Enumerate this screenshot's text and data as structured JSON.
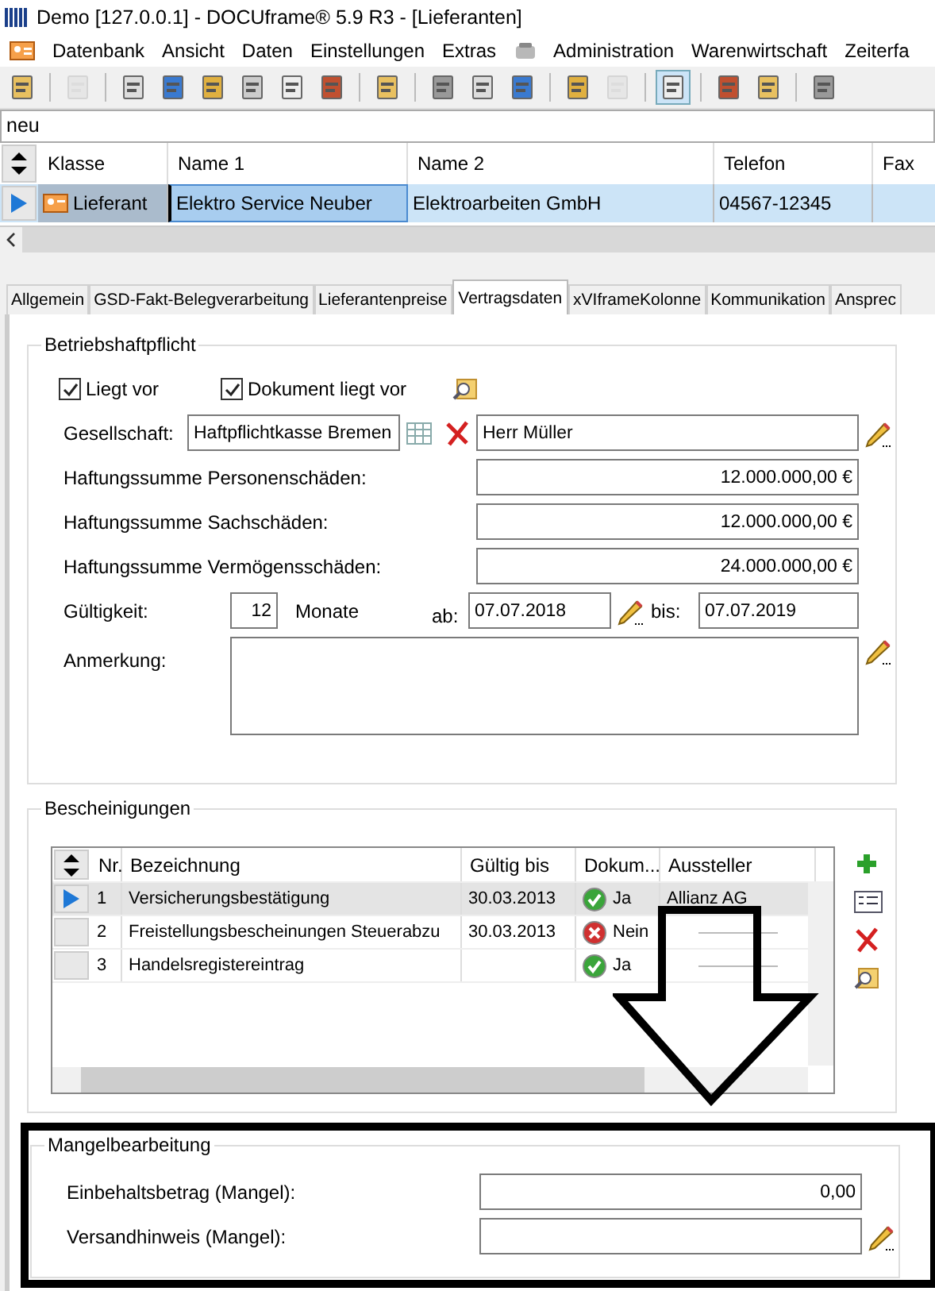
{
  "window": {
    "title": "Demo [127.0.0.1] - DOCUframe® 5.9 R3 - [Lieferanten]"
  },
  "menu": [
    "Datenbank",
    "Ansicht",
    "Daten",
    "Einstellungen",
    "Extras",
    "Administration",
    "Warenwirtschaft",
    "Zeiterfa"
  ],
  "toolbar": [
    {
      "disabled": false,
      "selected": false
    },
    {
      "disabled": true,
      "selected": false
    },
    {
      "disabled": false,
      "selected": false
    },
    {
      "disabled": false,
      "selected": false
    },
    {
      "disabled": false,
      "selected": false
    },
    {
      "disabled": false,
      "selected": false
    },
    {
      "disabled": false,
      "selected": false
    },
    {
      "disabled": false,
      "selected": false
    },
    {
      "disabled": false,
      "selected": false
    },
    {
      "disabled": false,
      "selected": false
    },
    {
      "disabled": false,
      "selected": false
    },
    {
      "disabled": false,
      "selected": false
    },
    {
      "disabled": false,
      "selected": false
    },
    {
      "disabled": true,
      "selected": false
    },
    {
      "disabled": false,
      "selected": true
    },
    {
      "disabled": false,
      "selected": false
    },
    {
      "disabled": false,
      "selected": false
    },
    {
      "disabled": false,
      "selected": false
    }
  ],
  "filter": {
    "value": "neu"
  },
  "grid": {
    "columns": [
      "Klasse",
      "Name 1",
      "Name 2",
      "Telefon",
      "Fax"
    ],
    "rows": [
      {
        "selected": true,
        "cells": [
          "Lieferant",
          "Elektro Service Neuber",
          "Elektroarbeiten GmbH",
          "04567-12345"
        ]
      }
    ]
  },
  "tabs": [
    {
      "label": "Allgemein",
      "selected": false
    },
    {
      "label": "GSD-Fakt-Belegverarbeitung",
      "selected": false
    },
    {
      "label": "Lieferantenpreise",
      "selected": false
    },
    {
      "label": "Vertragsdaten",
      "selected": true
    },
    {
      "label": "xVIframeKolonne",
      "selected": false
    },
    {
      "label": "Kommunikation",
      "selected": false
    },
    {
      "label": "Ansprec",
      "selected": false
    }
  ],
  "liability": {
    "title": "Betriebshaftpflicht",
    "checks": [
      {
        "label": "Liegt vor",
        "checked": true
      },
      {
        "label": "Dokument liegt vor",
        "checked": true
      }
    ],
    "company_label": "Gesellschaft:",
    "company": "Haftpflichtkasse Bremen",
    "contact": "Herr Müller",
    "sums": [
      {
        "label": "Haftungssumme Personenschäden:",
        "value": "12.000.000,00 €"
      },
      {
        "label": "Haftungssumme Sachschäden:",
        "value": "12.000.000,00 €"
      },
      {
        "label": "Haftungssumme Vermögensschäden:",
        "value": "24.000.000,00 €"
      }
    ],
    "validity_label": "Gültigkeit:",
    "months": "12",
    "months_label": "Monate",
    "from_label": "ab:",
    "from": "07.07.2018",
    "to_label": "bis:",
    "to": "07.07.2019",
    "note_label": "Anmerkung:"
  },
  "certificates": {
    "title": "Bescheinigungen",
    "columns": [
      "Nr.",
      "Bezeichnung",
      "Gültig bis",
      "Dokum...",
      "Aussteller"
    ],
    "rows": [
      {
        "selected": true,
        "nr": "1",
        "name": "Versicherungsbestätigung",
        "valid": "30.03.2013",
        "doc_ok": true,
        "doc": "Ja",
        "issuer": "Allianz AG"
      },
      {
        "selected": false,
        "nr": "2",
        "name": "Freistellungsbescheinungen Steuerabzu",
        "valid": "30.03.2013",
        "doc_ok": false,
        "doc": "Nein"
      },
      {
        "selected": false,
        "nr": "3",
        "name": "Handelsregistereintrag",
        "valid": "",
        "doc_ok": true,
        "doc": "Ja"
      }
    ]
  },
  "defects": {
    "title": "Mangelbearbeitung",
    "fields": [
      {
        "label": "Einbehaltsbetrag (Mangel):",
        "value": "0,00",
        "editable": false
      },
      {
        "label": "Versandhinweis (Mangel):",
        "editable": true
      }
    ]
  }
}
